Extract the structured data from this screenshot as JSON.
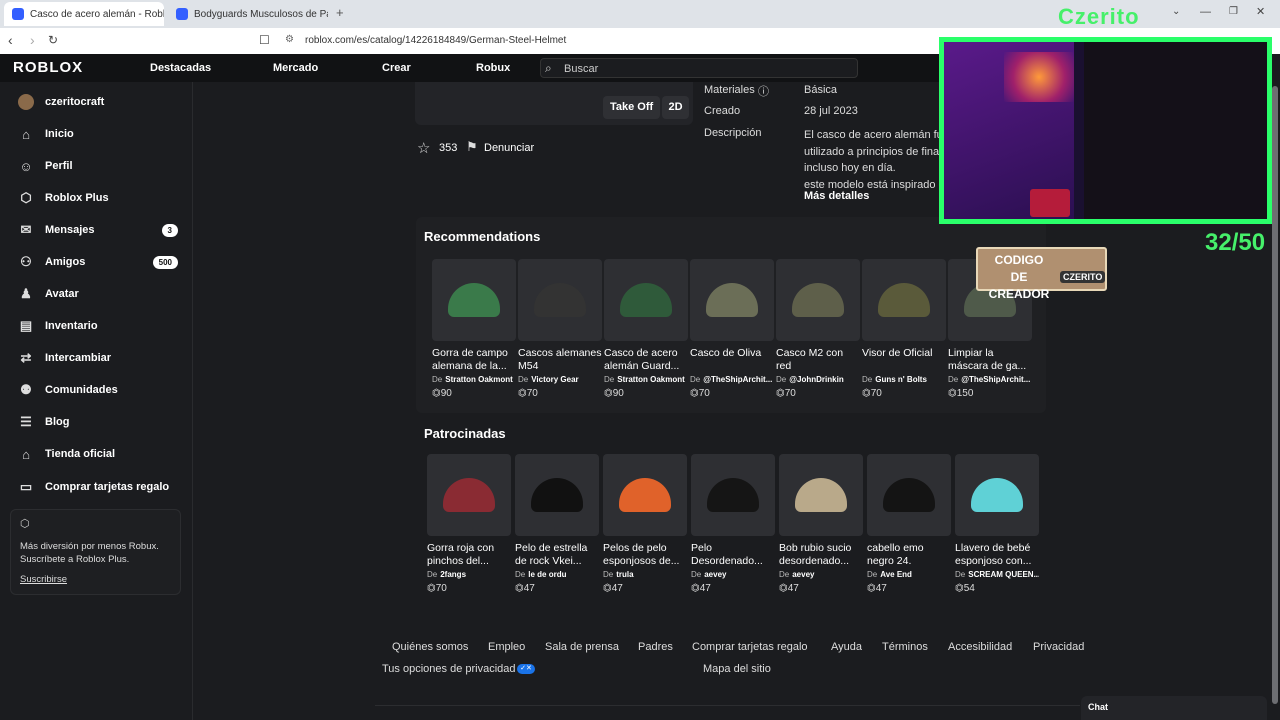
{
  "browser": {
    "tabs": [
      {
        "title": "Casco de acero alemán - Roblox"
      },
      {
        "title": "Bodyguards Musculosos de Pastor A"
      }
    ],
    "new_tab": "+",
    "url": "roblox.com/es/catalog/14226184849/German-Steel-Helmet"
  },
  "header": {
    "logo": "ROBLOX",
    "nav": [
      "Destacadas",
      "Mercado",
      "Crear",
      "Robux"
    ],
    "search_placeholder": "Buscar"
  },
  "sidebar": {
    "user": "czeritocraft",
    "items": [
      {
        "label": "Inicio",
        "icon": "home-icon"
      },
      {
        "label": "Perfil",
        "icon": "user-icon"
      },
      {
        "label": "Roblox Plus",
        "icon": "plus-icon"
      },
      {
        "label": "Mensajes",
        "icon": "message-icon",
        "badge": "3"
      },
      {
        "label": "Amigos",
        "icon": "friends-icon",
        "badge": "500"
      },
      {
        "label": "Avatar",
        "icon": "avatar-icon"
      },
      {
        "label": "Inventario",
        "icon": "inventory-icon"
      },
      {
        "label": "Intercambiar",
        "icon": "trade-icon"
      },
      {
        "label": "Comunidades",
        "icon": "communities-icon"
      },
      {
        "label": "Blog",
        "icon": "blog-icon"
      },
      {
        "label": "Tienda oficial",
        "icon": "shop-icon"
      },
      {
        "label": "Comprar tarjetas regalo",
        "icon": "gift-card-icon"
      }
    ],
    "promo": {
      "text": "Más diversión por menos Robux. Suscríbete a Roblox Plus.",
      "link": "Suscribirse"
    }
  },
  "item": {
    "take_off": "Take Off",
    "view_2d": "2D",
    "favorites": "353",
    "report": "Denunciar",
    "details": [
      {
        "label": "Materiales",
        "value": "Básica"
      },
      {
        "label": "Creado",
        "value": "28 jul 2023"
      }
    ],
    "description_label": "Descripción",
    "description": [
      "El casco de acero alemán fue",
      "utilizado a principios de finale",
      "incluso hoy en día.",
      "este modelo está inspirado en"
    ],
    "more_details": "Más detalles"
  },
  "recommendations": {
    "title": "Recommendations",
    "items": [
      {
        "name": "Gorra de campo alemana de la...",
        "by": "Stratton Oakmont",
        "price": "90",
        "color": "#3a7a4a"
      },
      {
        "name": "Cascos alemanes M54",
        "by": "Victory Gear",
        "price": "70",
        "color": "#333333"
      },
      {
        "name": "Casco de acero alemán Guard...",
        "by": "Stratton Oakmont",
        "price": "90",
        "color": "#2f5a3a"
      },
      {
        "name": "Casco de Oliva",
        "by": "@TheShipArchit...",
        "price": "70",
        "color": "#6b6e57"
      },
      {
        "name": "Casco M2 con red",
        "by": "@JohnDrinkin",
        "price": "70",
        "color": "#5e5f4a"
      },
      {
        "name": "Visor de Oficial",
        "by": "Guns n' Bolts",
        "price": "70",
        "color": "#5a5a3a"
      },
      {
        "name": "Limpiar la máscara de ga...",
        "by": "@TheShipArchit...",
        "price": "150",
        "color": "#4f5a4a"
      }
    ]
  },
  "sponsored": {
    "title": "Patrocinadas",
    "items": [
      {
        "name": "Gorra roja con pinchos del...",
        "by": "2fangs",
        "price": "70",
        "color": "#8a2b33"
      },
      {
        "name": "Pelo de estrella de rock Vkei...",
        "by": "le de ordu",
        "price": "47",
        "color": "#111111"
      },
      {
        "name": "Pelos de pelo esponjosos de...",
        "by": "trula",
        "price": "47",
        "color": "#e0622a"
      },
      {
        "name": "Pelo Desordenado...",
        "by": "aevey",
        "price": "47",
        "color": "#151515"
      },
      {
        "name": "Bob rubio sucio desordenado...",
        "by": "aevey",
        "price": "47",
        "color": "#b9a98a"
      },
      {
        "name": "cabello emo negro 24.",
        "by": "Ave End",
        "price": "47",
        "color": "#141414"
      },
      {
        "name": "Llavero de bebé esponjoso con...",
        "by": "SCREAM QUEEN...",
        "price": "54",
        "color": "#5fd1d6"
      }
    ]
  },
  "by_label": "De",
  "footer": {
    "links": [
      "Quiénes somos",
      "Empleo",
      "Sala de prensa",
      "Padres",
      "Comprar tarjetas regalo",
      "Ayuda",
      "Términos",
      "Accesibilidad",
      "Privacidad"
    ],
    "privacy_choices": "Tus opciones de privacidad",
    "sitemap": "Mapa del sitio"
  },
  "chat": "Chat",
  "stream": {
    "name": "Czerito",
    "counter": "32/50",
    "creator_code_line1": "CODIGO",
    "creator_code_line2": "DE CREADOR",
    "creator_tag": "CZERITO"
  }
}
